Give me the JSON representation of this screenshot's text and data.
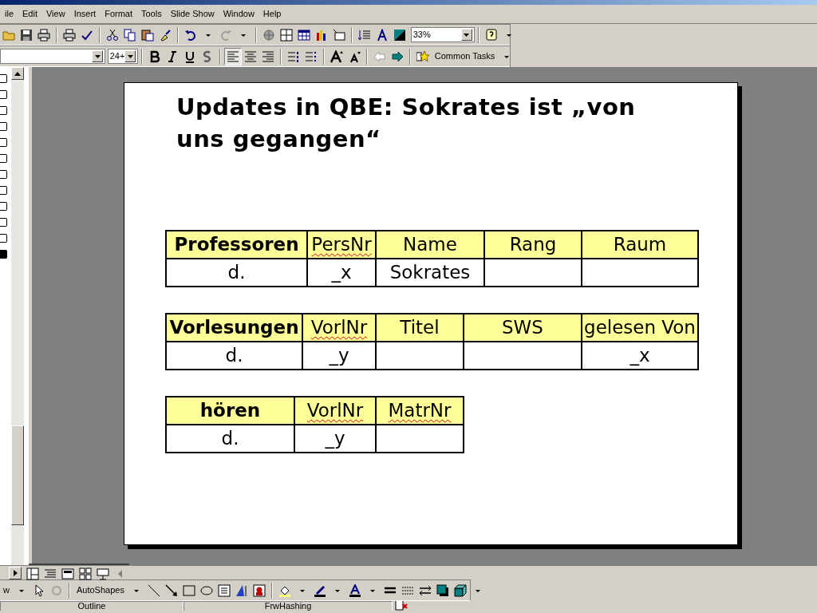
{
  "menu": [
    "ile",
    "Edit",
    "View",
    "Insert",
    "Format",
    "Tools",
    "Slide Show",
    "Window",
    "Help"
  ],
  "standard_toolbar": {
    "zoom": "33%"
  },
  "formatting_toolbar": {
    "font_size": "24+",
    "alignment_buttons": [
      {
        "selected": true
      },
      {
        "selected": false
      },
      {
        "selected": false
      }
    ],
    "common_tasks": "Common Tasks"
  },
  "outline": {
    "slides": [
      {
        "selected": false
      },
      {
        "selected": false
      },
      {
        "selected": false
      },
      {
        "selected": false
      },
      {
        "selected": false
      },
      {
        "selected": false
      },
      {
        "selected": false
      },
      {
        "selected": false
      },
      {
        "selected": false
      },
      {
        "selected": false
      },
      {
        "selected": false
      },
      {
        "selected": true
      }
    ]
  },
  "slide": {
    "title": "Updates in QBE: Sokrates ist „von uns gegangen“",
    "tables": [
      {
        "columns": [
          {
            "text": "Professoren",
            "misspelled": false
          },
          {
            "text": "PersNr",
            "misspelled": true
          },
          {
            "text": "Name",
            "misspelled": false
          },
          {
            "text": "Rang",
            "misspelled": false
          },
          {
            "text": "Raum",
            "misspelled": false
          }
        ],
        "rows": [
          [
            "d.",
            "_x",
            "Sokrates",
            null,
            null
          ]
        ]
      },
      {
        "columns": [
          {
            "text": "Vorlesungen",
            "misspelled": false
          },
          {
            "text": "VorlNr",
            "misspelled": true
          },
          {
            "text": "Titel",
            "misspelled": false
          },
          {
            "text": "SWS",
            "misspelled": false
          },
          {
            "text": "gelesen Von",
            "misspelled": false
          }
        ],
        "rows": [
          [
            "d.",
            "_y",
            null,
            null,
            "_x"
          ]
        ]
      },
      {
        "columns": [
          {
            "text": "hören",
            "misspelled": false
          },
          {
            "text": "VorlNr",
            "misspelled": true
          },
          {
            "text": "MatrNr",
            "misspelled": true
          }
        ],
        "rows": [
          [
            "d.",
            "_y",
            null
          ]
        ]
      }
    ]
  },
  "drawing_toolbar": {
    "draw": "w",
    "autoshapes": "AutoShapes"
  },
  "status_bar": [
    "Outline",
    "FrwHashing"
  ]
}
